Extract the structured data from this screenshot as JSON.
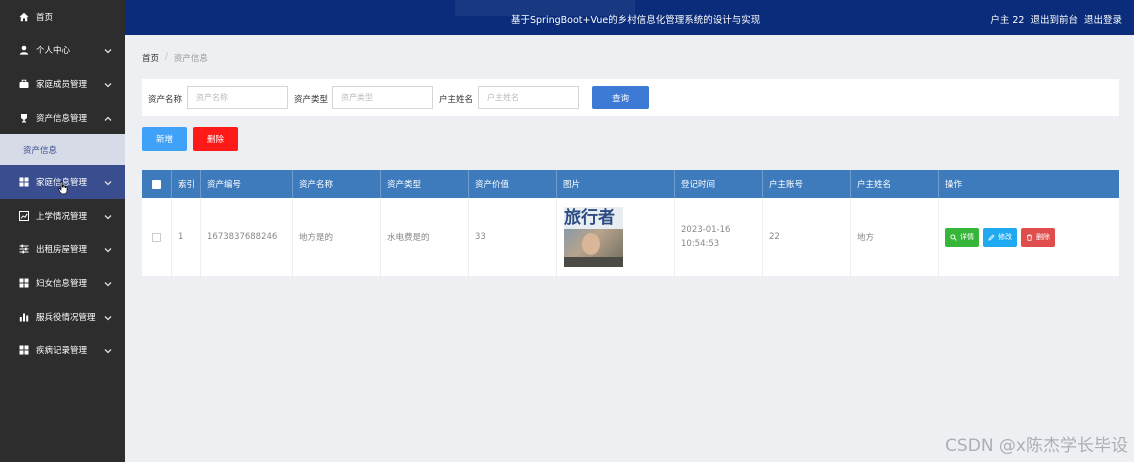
{
  "sidebar": {
    "items": [
      {
        "label": "首页",
        "icon": "home-icon"
      },
      {
        "label": "个人中心",
        "icon": "user-icon"
      },
      {
        "label": "家庭成员管理",
        "icon": "briefcase-icon"
      },
      {
        "label": "资产信息管理",
        "icon": "trophy-icon"
      },
      {
        "label": "家庭信息管理",
        "icon": "grid-icon"
      },
      {
        "label": "上学情况管理",
        "icon": "chart-line-icon"
      },
      {
        "label": "出租房屋管理",
        "icon": "sliders-icon"
      },
      {
        "label": "妇女信息管理",
        "icon": "grid-icon"
      },
      {
        "label": "服兵役情况管理",
        "icon": "bar-chart-icon"
      },
      {
        "label": "疾病记录管理",
        "icon": "grid-icon"
      }
    ],
    "submenu_label": "资产信息"
  },
  "topbar": {
    "title": "基于SpringBoot+Vue的乡村信息化管理系统的设计与实现",
    "user_label": "户主 22",
    "to_front_label": "退出到前台",
    "logout_label": "退出登录"
  },
  "breadcrumb": {
    "home": "首页",
    "current": "资产信息"
  },
  "search": {
    "fields": [
      {
        "label": "资产名称",
        "placeholder": "资产名称"
      },
      {
        "label": "资产类型",
        "placeholder": "资产类型"
      },
      {
        "label": "户主姓名",
        "placeholder": "户主姓名"
      }
    ],
    "query_label": "查询"
  },
  "actions": {
    "add_label": "新增",
    "delete_label": "删除"
  },
  "table": {
    "headers": [
      "索引",
      "资产编号",
      "资产名称",
      "资产类型",
      "资产价值",
      "图片",
      "登记时间",
      "户主账号",
      "户主姓名",
      "操作"
    ],
    "rows": [
      {
        "index": "1",
        "asset_no": "1673837688246",
        "asset_name": "地方是的",
        "asset_type": "水电费是的",
        "asset_value": "33",
        "image_text": "旅行者",
        "reg_time": "2023-01-16 10:54:53",
        "owner_account": "22",
        "owner_name": "地方",
        "detail_label": "详情",
        "edit_label": "修改",
        "delete_label": "删除"
      }
    ]
  },
  "watermark": "CSDN @x陈杰学长毕设",
  "colors": {
    "sidebar_bg": "#2d2d2d",
    "topbar_bg": "#0a2c7a",
    "table_header": "#3d7bbd",
    "query_button": "#3d7ad6",
    "add_button": "#3fa1f7",
    "delete_button": "#ff1a1a"
  }
}
